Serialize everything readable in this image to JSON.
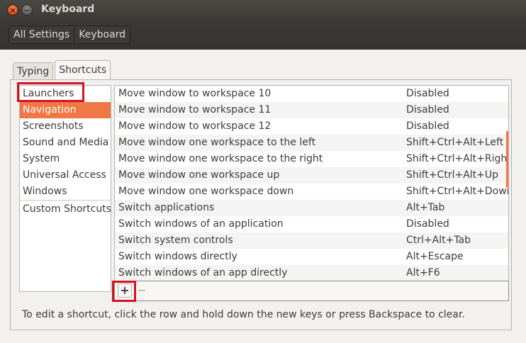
{
  "window": {
    "title": "Keyboard",
    "close_glyph": "×",
    "minimize_glyph": "−"
  },
  "toolbar": {
    "crumbs": [
      "All Settings",
      "Keyboard"
    ]
  },
  "tabs": [
    {
      "label": "Typing",
      "active": false
    },
    {
      "label": "Shortcuts",
      "active": true
    }
  ],
  "categories": {
    "items": [
      "Launchers",
      "Navigation",
      "Screenshots",
      "Sound and Media",
      "System",
      "Universal Access",
      "Windows"
    ],
    "selected": "Navigation",
    "custom": "Custom Shortcuts"
  },
  "shortcuts": {
    "rows": [
      {
        "name": "Move window to workspace 10",
        "accel": "Disabled"
      },
      {
        "name": "Move window to workspace 11",
        "accel": "Disabled"
      },
      {
        "name": "Move window to workspace 12",
        "accel": "Disabled"
      },
      {
        "name": "Move window one workspace to the left",
        "accel": "Shift+Ctrl+Alt+Left"
      },
      {
        "name": "Move window one workspace to the right",
        "accel": "Shift+Ctrl+Alt+Right"
      },
      {
        "name": "Move window one workspace up",
        "accel": "Shift+Ctrl+Alt+Up"
      },
      {
        "name": "Move window one workspace down",
        "accel": "Shift+Ctrl+Alt+Down"
      },
      {
        "name": "Switch applications",
        "accel": "Alt+Tab"
      },
      {
        "name": "Switch windows of an application",
        "accel": "Disabled"
      },
      {
        "name": "Switch system controls",
        "accel": "Ctrl+Alt+Tab"
      },
      {
        "name": "Switch windows directly",
        "accel": "Alt+Escape"
      },
      {
        "name": "Switch windows of an app directly",
        "accel": "Alt+F6"
      }
    ]
  },
  "editbar": {
    "add_glyph": "+",
    "remove_glyph": "−"
  },
  "hint": "To edit a shortcut, click the row and hold down the new keys or press Backspace to clear.",
  "colors": {
    "accent": "#f07746",
    "highlight": "#d6121f",
    "titlebar": "#3c3b37"
  }
}
